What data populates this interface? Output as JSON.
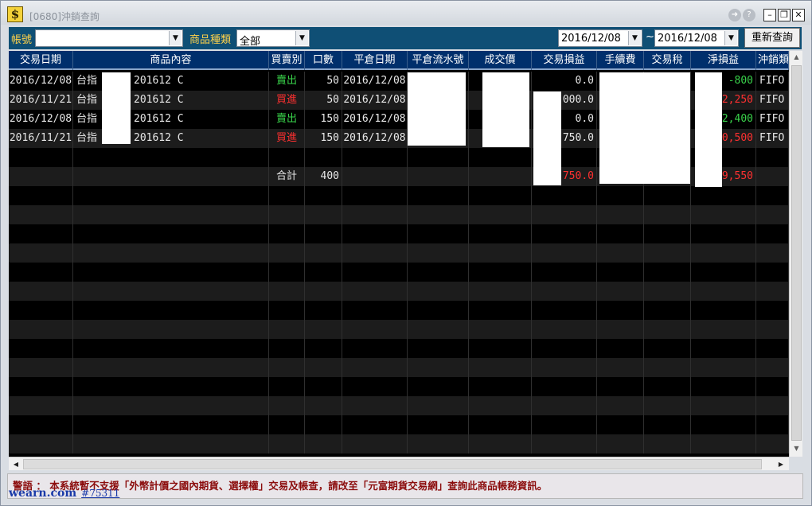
{
  "window": {
    "title": "[0680]沖銷查詢",
    "app_icon": "$",
    "buttons": [
      "export-icon",
      "help-icon",
      "minimize-icon",
      "restore-icon",
      "close-icon"
    ]
  },
  "toolbar": {
    "account_label": "帳號",
    "account_value": "",
    "product_type_label": "商品種類",
    "product_type_value": "全部",
    "date_from": "2016/12/08",
    "date_sep": "~",
    "date_to": "2016/12/08",
    "requery_label": "重新查詢"
  },
  "table": {
    "columns": [
      "交易日期",
      "商品內容",
      "買賣別",
      "口數",
      "平倉日期",
      "平倉流水號",
      "成交價",
      "交易損益",
      "手續費",
      "交易稅",
      "淨損益",
      "沖銷類"
    ],
    "rows": [
      {
        "trade_date": "2016/12/08",
        "product_a": "台指",
        "product_b": "201612 C",
        "side": "賣出",
        "side_type": "sell",
        "qty": "50",
        "close_date": "2016/12/08",
        "serial": "",
        "price": "",
        "pnl": "0.0",
        "fee": "",
        "tax": "",
        "net": "-800",
        "net_color": "green",
        "method": "FIFO"
      },
      {
        "trade_date": "2016/11/21",
        "product_a": "台指",
        "product_b": "201612 C",
        "side": "買進",
        "side_type": "buy",
        "qty": "50",
        "close_date": "2016/12/08",
        "serial": "",
        "price": "",
        "pnl": ",000.0",
        "fee": "",
        "tax": "",
        "net": "42,250",
        "net_color": "red",
        "method": "FIFO"
      },
      {
        "trade_date": "2016/12/08",
        "product_a": "台指",
        "product_b": "201612 C",
        "side": "賣出",
        "side_type": "sell",
        "qty": "150",
        "close_date": "2016/12/08",
        "serial": "",
        "price": "",
        "pnl": "0.0",
        "fee": "",
        "tax": "",
        "net": "-2,400",
        "net_color": "green",
        "method": "FIFO"
      },
      {
        "trade_date": "2016/11/21",
        "product_a": "台指",
        "product_b": "201612 C",
        "side": "買進",
        "side_type": "buy",
        "qty": "150",
        "close_date": "2016/12/08",
        "serial": "",
        "price": "",
        "pnl": ",750.0",
        "fee": "",
        "tax": "",
        "net": "30,500",
        "net_color": "red",
        "method": "FIFO"
      }
    ],
    "total": {
      "label": "合計",
      "qty": "400",
      "pnl": "750.0",
      "net": "69,550"
    }
  },
  "warning": "警語 ： 本系統暫不支援「外幣計價之國內期貨、選擇權」交易及帳查，請改至「元富期貨交易網」查詢此商品帳務資訊。",
  "watermark": {
    "site": "wearn.com",
    "id": "#75311"
  }
}
